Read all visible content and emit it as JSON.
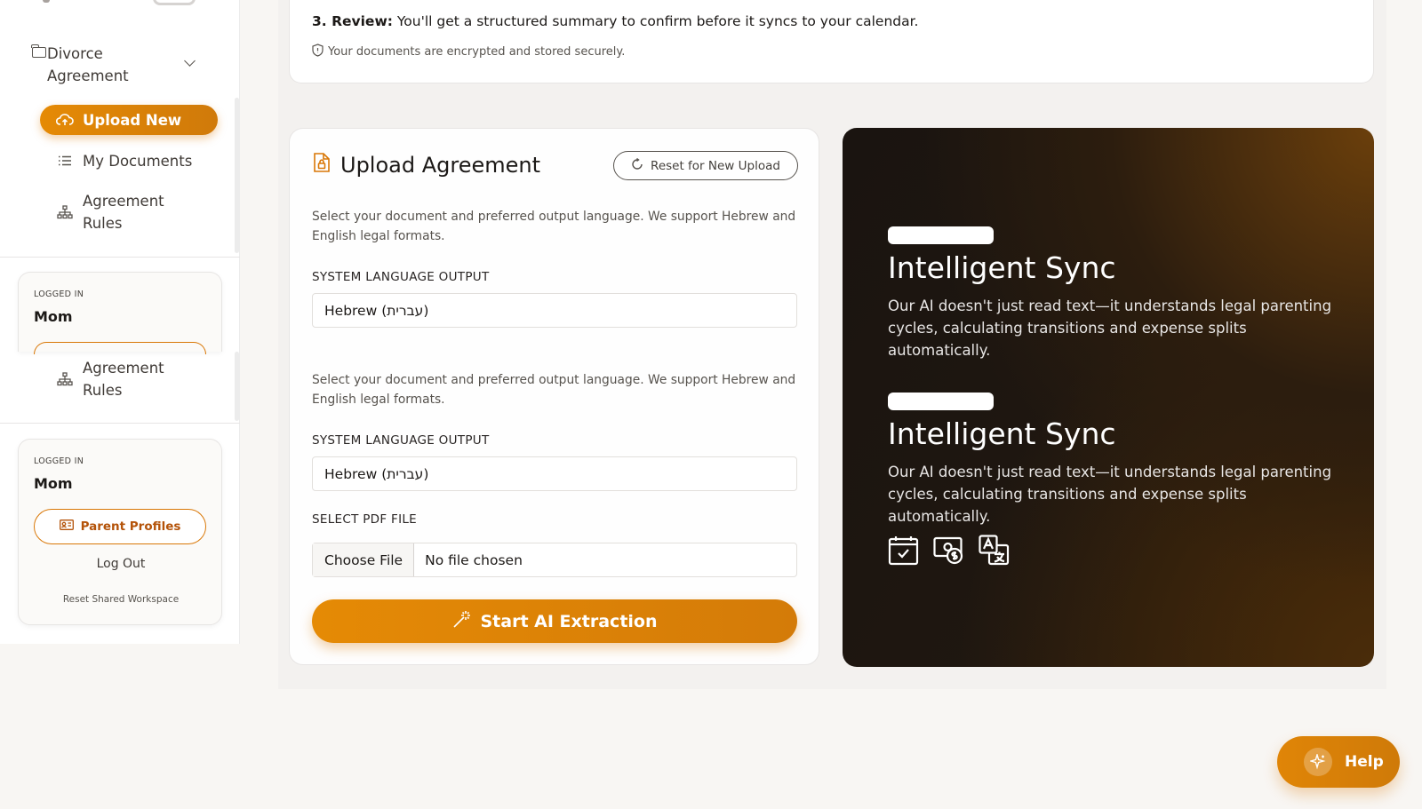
{
  "sidebar": {
    "group_label": "Divorce Agreement",
    "items": [
      {
        "label": "Upload New",
        "icon": "cloud-upload-icon"
      },
      {
        "label": "My Documents",
        "icon": "list-icon"
      },
      {
        "label": "Agreement Rules",
        "icon": "hierarchy-icon"
      }
    ],
    "user": {
      "logged_in_label": "LOGGED IN",
      "name": "Mom",
      "parent_profiles": "Parent Profiles",
      "logout": "Log Out",
      "reset_workspace": "Reset Shared Workspace"
    }
  },
  "info": {
    "review_bold": "3. Review:",
    "review_text": " You'll get a structured summary to confirm before it syncs to your calendar.",
    "secure_text": "Your documents are encrypted and stored securely."
  },
  "upload": {
    "title": "Upload Agreement",
    "reset_label": "Reset for New Upload",
    "description": "Select your document and preferred output language. We support Hebrew and English legal formats.",
    "language_label": "SYSTEM LANGUAGE OUTPUT",
    "language_value": "Hebrew (עברית)",
    "pdf_label": "SELECT PDF FILE",
    "choose_file": "Choose File",
    "no_file": "No file chosen",
    "start_label": "Start AI Extraction"
  },
  "promo": {
    "title": "Intelligent Sync",
    "description": "Our AI doesn't just read text—it understands legal parenting cycles, calculating transitions and expense splits automatically.",
    "icons": [
      "calendar-check-icon",
      "money-icon",
      "translate-icon"
    ]
  },
  "help": {
    "label": "Help"
  },
  "colors": {
    "accent": "#d97706",
    "dark_card": "#1f1710"
  }
}
